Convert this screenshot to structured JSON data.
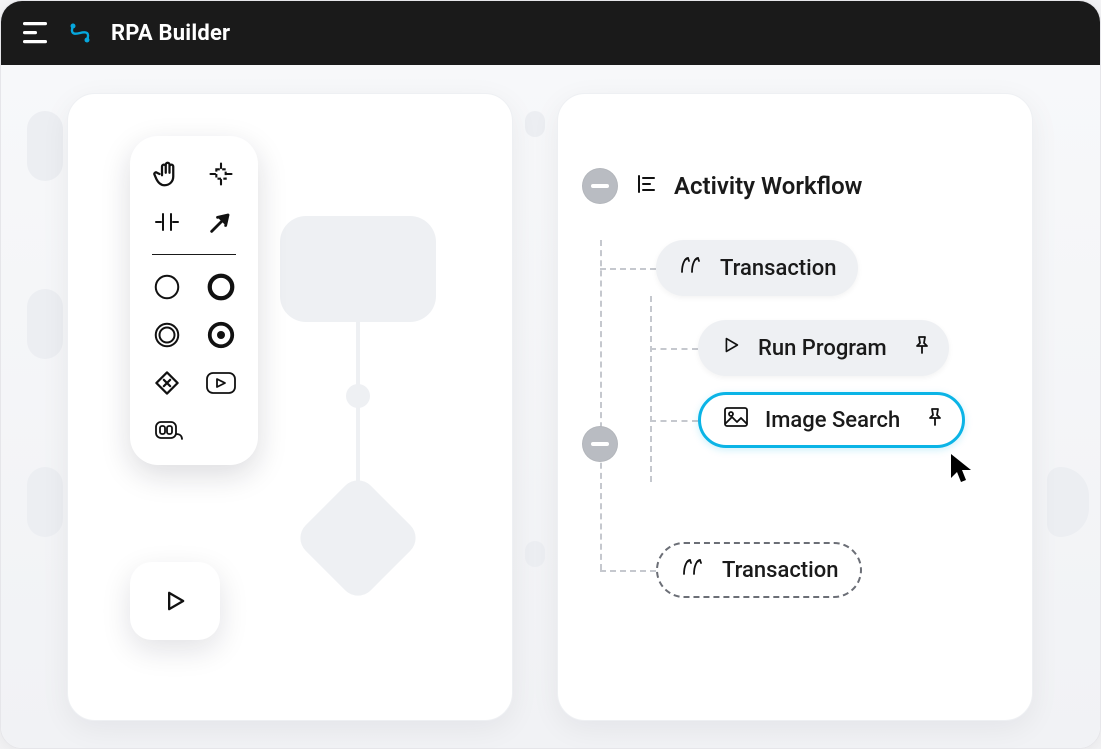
{
  "app": {
    "title": "RPA Builder"
  },
  "toolbox": {
    "tools": [
      "hand",
      "crop",
      "split",
      "arrow",
      "circle-thin",
      "circle-bold",
      "circle-double",
      "circle-target",
      "diamond-x",
      "rounded-triangle",
      "keyboard"
    ]
  },
  "workflow": {
    "title": "Activity Workflow",
    "nodes": {
      "transaction1": {
        "label": "Transaction"
      },
      "run_program": {
        "label": "Run Program"
      },
      "image_search": {
        "label": "Image Search"
      },
      "transaction2": {
        "label": "Transaction"
      }
    }
  },
  "colors": {
    "accent": "#0bb4e6",
    "grey_chip": "#eef0f3",
    "collapse": "#b9bcc2"
  }
}
